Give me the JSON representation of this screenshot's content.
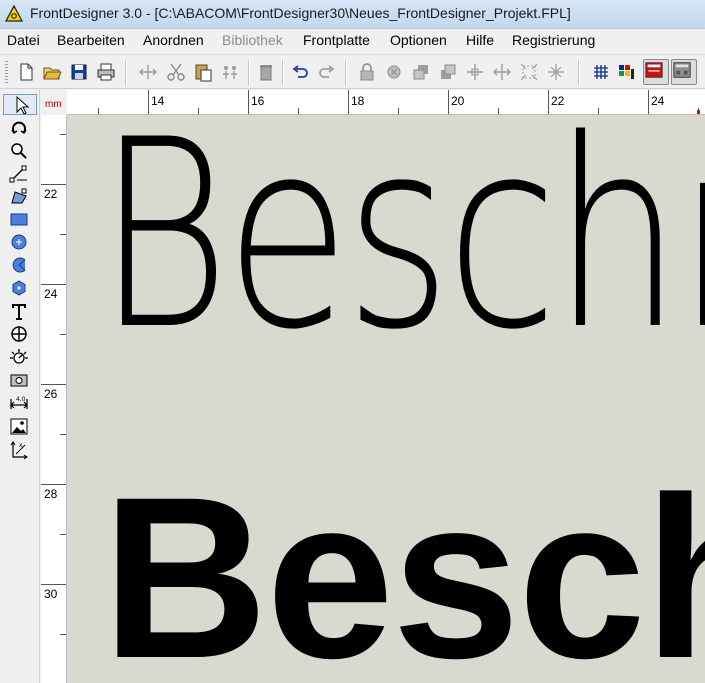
{
  "window": {
    "title": "FrontDesigner 3.0 - [C:\\ABACOM\\FrontDesigner30\\Neues_FrontDesigner_Projekt.FPL]"
  },
  "menu": {
    "items": [
      {
        "label": "Datei",
        "enabled": true
      },
      {
        "label": "Bearbeiten",
        "enabled": true
      },
      {
        "label": "Anordnen",
        "enabled": true
      },
      {
        "label": "Bibliothek",
        "enabled": false
      },
      {
        "label": "Frontplatte",
        "enabled": true
      },
      {
        "label": "Optionen",
        "enabled": true
      },
      {
        "label": "Hilfe",
        "enabled": true
      },
      {
        "label": "Registrierung",
        "enabled": true
      }
    ]
  },
  "toolbar": {
    "buttons": [
      "new-file-icon",
      "open-folder-icon",
      "save-icon",
      "print-icon",
      "mirror-icon",
      "cut-icon",
      "paste-icon",
      "group-icon",
      "delete-icon",
      "undo-icon",
      "redo-icon",
      "lock-icon",
      "lock-pattern-icon",
      "to-back-icon",
      "to-front-icon",
      "align-center-icon",
      "distribute-icon",
      "fit-icon",
      "split-icon",
      "grid-icon",
      "colors-icon",
      "front-panel-view-icon",
      "rear-panel-view-icon"
    ]
  },
  "toolbox": {
    "tools": [
      "select-arrow-icon",
      "rotate-icon",
      "zoom-icon",
      "line-icon",
      "polygon-icon",
      "rectangle-icon",
      "circle-icon",
      "arc-icon",
      "hexagon-icon",
      "text-tool-icon",
      "drill-hole-icon",
      "knob-scale-icon",
      "cutout-icon",
      "dimension-icon",
      "image-icon",
      "measure-icon"
    ]
  },
  "ruler": {
    "unit": "mm",
    "horizontal_labels": [
      "14",
      "16",
      "18",
      "20",
      "22",
      "24"
    ],
    "vertical_labels": [
      "22",
      "24",
      "26",
      "28",
      "30"
    ]
  },
  "canvas": {
    "background": "#d9d9cf",
    "text_thin": "Beschr",
    "text_bold": "Besch"
  }
}
